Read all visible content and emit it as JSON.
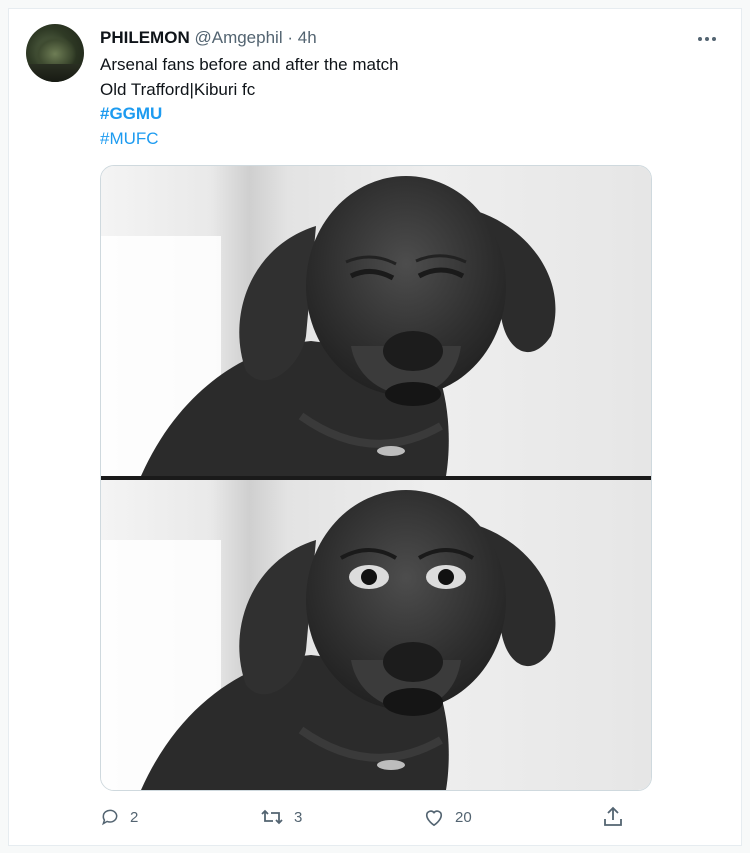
{
  "author": {
    "name": "PHILEMON",
    "handle": "@Amgephil",
    "separator": "·",
    "time": "4h"
  },
  "tweet": {
    "line1": "Arsenal fans before and after the match",
    "line2": "Old Trafford|Kiburi fc",
    "hashtag1": "#GGMU",
    "hashtag2": "#MUFC"
  },
  "media": {
    "top_panel_icon": "dog-squinting-meme",
    "bottom_panel_icon": "dog-wide-eyed-meme"
  },
  "actions": {
    "reply_count": "2",
    "retweet_count": "3",
    "like_count": "20"
  },
  "icons": {
    "more": "more-options-icon",
    "reply": "reply-icon",
    "retweet": "retweet-icon",
    "like": "heart-icon",
    "share": "share-icon"
  },
  "colors": {
    "hashtag": "#1d9bf0",
    "secondary_text": "#536471",
    "border": "#cfd9de"
  }
}
